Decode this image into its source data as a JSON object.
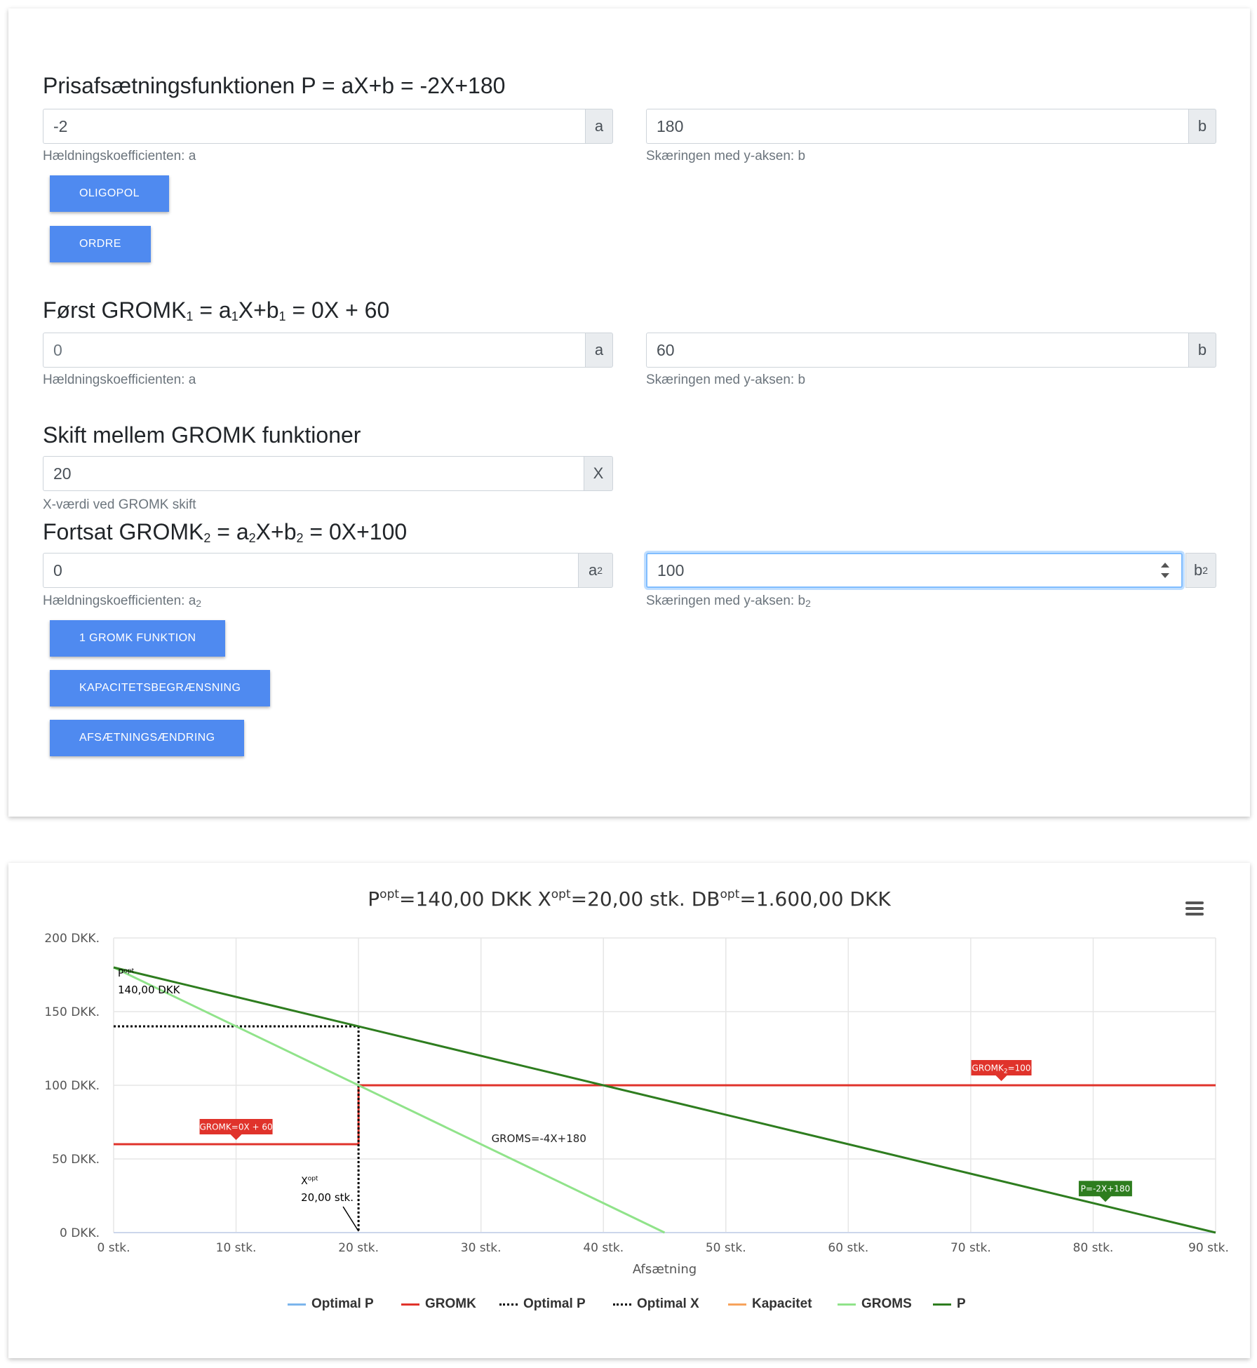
{
  "price_section": {
    "title": "Prisafsætningsfunktionen P = aX+b = -2X+180",
    "a": {
      "value": "-2",
      "addon": "a",
      "help": "Hældningskoefficienten: a"
    },
    "b": {
      "value": "180",
      "addon": "b",
      "help": "Skæringen med y-aksen: b"
    },
    "buttons": {
      "oligopol": "OLIGOPOL",
      "ordre": "ORDRE"
    }
  },
  "gromk1_section": {
    "title_pre": "Først GROMK",
    "title_sub1": "1",
    "title_mid": " = a",
    "title_sub2": "1",
    "title_mid2": "X+b",
    "title_sub3": "1",
    "title_post": " = 0X + 60",
    "a": {
      "value": "0",
      "addon": "a",
      "help": "Hældningskoefficienten: a"
    },
    "b": {
      "value": "60",
      "addon": "b",
      "help": "Skæringen med y-aksen: b"
    }
  },
  "switch_section": {
    "title": "Skift mellem GROMK funktioner",
    "x": {
      "value": "20",
      "addon": "X",
      "help": "X-værdi ved GROMK skift"
    }
  },
  "gromk2_section": {
    "title_pre": "Fortsat GROMK",
    "title_sub1": "2",
    "title_mid": " = a",
    "title_sub2": "2",
    "title_mid2": "X+b",
    "title_sub3": "2",
    "title_post": " = 0X+100",
    "a": {
      "value": "0",
      "addon_base": "a",
      "addon_sub": "2",
      "help_base": "Hældningskoefficienten: a",
      "help_sub": "2"
    },
    "b": {
      "value": "100",
      "addon_base": "b",
      "addon_sub": "2",
      "help_base": "Skæringen med y-aksen: b",
      "help_sub": "2"
    },
    "buttons": {
      "one_gromk": "1 GROMK FUNKTION",
      "kapacitet": "KAPACITETSBEGRÆNSNING",
      "afsaetning": "AFSÆTNINGSÆNDRING"
    }
  },
  "chart_data": {
    "type": "line",
    "title_parts": [
      {
        "base": "P",
        "sup": "opt",
        "text": "=140,00 DKK "
      },
      {
        "base": "X",
        "sup": "opt",
        "text": "=20,00 stk. "
      },
      {
        "base": "DB",
        "sup": "opt",
        "text": "=1.600,00 DKK"
      }
    ],
    "xlabel": "Afsætning",
    "ylabel": "",
    "xlim": [
      0,
      90
    ],
    "ylim": [
      0,
      200
    ],
    "x_ticks": [
      0,
      10,
      20,
      30,
      40,
      50,
      60,
      70,
      80,
      90
    ],
    "x_tick_labels": [
      "0 stk.",
      "10 stk.",
      "20 stk.",
      "30 stk.",
      "40 stk.",
      "50 stk.",
      "60 stk.",
      "70 stk.",
      "80 stk.",
      "90 stk."
    ],
    "y_ticks": [
      0,
      50,
      100,
      150,
      200
    ],
    "y_tick_labels": [
      "0 DKK.",
      "50 DKK.",
      "100 DKK.",
      "150 DKK.",
      "200 DKK."
    ],
    "grid": true,
    "legend_position": "bottom-center",
    "series": [
      {
        "name": "Optimal P",
        "color": "#7cb5ec",
        "style": "solid",
        "points": []
      },
      {
        "name": "GROMK",
        "color": "#e0332b",
        "style": "solid",
        "segments": [
          [
            [
              0,
              60
            ],
            [
              20,
              60
            ]
          ],
          [
            [
              20,
              60
            ],
            [
              20,
              100
            ]
          ],
          [
            [
              20,
              100
            ],
            [
              90,
              100
            ]
          ]
        ]
      },
      {
        "name": "Optimal P",
        "color": "#000000",
        "style": "dotted",
        "points": [
          [
            0,
            140
          ],
          [
            20,
            140
          ]
        ]
      },
      {
        "name": "Optimal X",
        "color": "#000000",
        "style": "dotted",
        "points": [
          [
            20,
            140
          ],
          [
            20,
            0
          ]
        ]
      },
      {
        "name": "Kapacitet",
        "color": "#f7a35c",
        "style": "solid",
        "points": []
      },
      {
        "name": "GROMS",
        "color": "#90e38a",
        "style": "solid",
        "points": [
          [
            0,
            180
          ],
          [
            45,
            0
          ]
        ]
      },
      {
        "name": "P",
        "color": "#2e7d1f",
        "style": "solid",
        "points": [
          [
            0,
            180
          ],
          [
            90,
            0
          ]
        ]
      }
    ],
    "annotations": [
      {
        "base": "P",
        "sup": "opt",
        "value": "140,00 DKK",
        "x": 0,
        "y": 140
      },
      {
        "base": "X",
        "sup": "opt",
        "value": "20,00 stk.",
        "x": 20,
        "y": 0
      },
      {
        "text": "GROMS=-4X+180",
        "x": 32,
        "y": 55
      }
    ],
    "flags": [
      {
        "text": "GROMK=0X + 60",
        "color": "#e0332b",
        "x": 10,
        "y": 60
      },
      {
        "text_base": "GROMK",
        "text_sub": "2",
        "text_post": "=100",
        "color": "#e0332b",
        "x": 72.5,
        "y": 100
      },
      {
        "text": "P=-2X+180",
        "color": "#2e7d1f",
        "x": 81,
        "y": 18
      }
    ]
  },
  "menu_icon": "hamburger-menu-icon"
}
